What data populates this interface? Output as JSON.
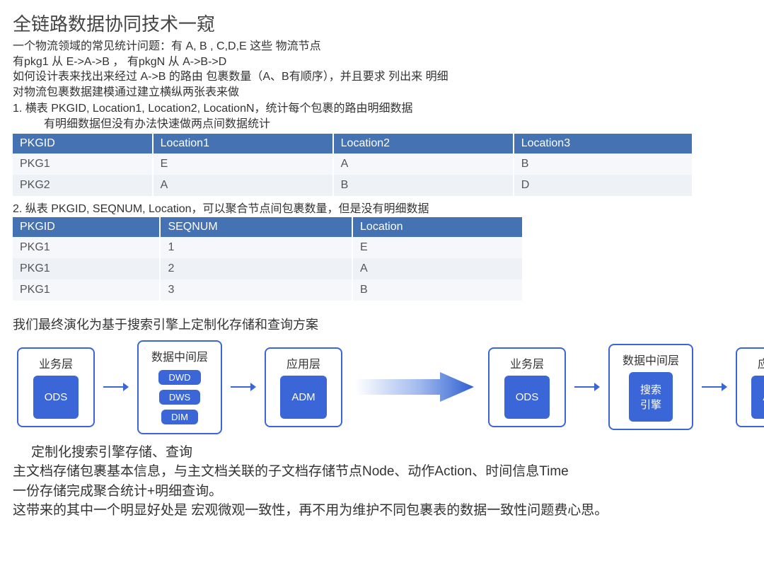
{
  "title": "全链路数据协同技术一窥",
  "intro": {
    "l1": "一个物流领域的常见统计问题：有 A, B , C,D,E 这些 物流节点",
    "l2": "有pkg1 从 E->A->B ，  有pkgN  从 A->B->D",
    "l3": "如何设计表来找出来经过 A->B 的路由 包裹数量（A、B有顺序），并且要求 列出来 明细",
    "l4": "对物流包裹数据建模通过建立横纵两张表来做",
    "list1": "1.     横表 PKGID, Location1, Location2, LocationN，统计每个包裹的路由明细数据",
    "list1sub": "有明细数据但没有办法快速做两点间数据统计"
  },
  "table1": {
    "headers": [
      "PKGID",
      "Location1",
      "Location2",
      "Location3"
    ],
    "rows": [
      [
        "PKG1",
        "E",
        "A",
        "B"
      ],
      [
        "PKG2",
        "A",
        "B",
        "D"
      ]
    ]
  },
  "mid": "2. 纵表 PKGID, SEQNUM, Location，可以聚合节点间包裹数量，但是没有明细数据",
  "table2": {
    "headers": [
      "PKGID",
      "SEQNUM",
      "Location"
    ],
    "rows": [
      [
        "PKG1",
        "1",
        "E"
      ],
      [
        "PKG1",
        "2",
        "A"
      ],
      [
        "PKG1",
        "3",
        "B"
      ]
    ]
  },
  "evolution": "我们最终演化为基于搜索引擎上定制化存储和查询方案",
  "diagram": {
    "left": {
      "biz": {
        "title": "业务层",
        "block": "ODS"
      },
      "mid": {
        "title": "数据中间层",
        "blocks": [
          "DWD",
          "DWS",
          "DIM"
        ]
      },
      "app": {
        "title": "应用层",
        "block": "ADM"
      }
    },
    "right": {
      "biz": {
        "title": "业务层",
        "block": "ODS"
      },
      "mid": {
        "title": "数据中间层",
        "block": "搜索\n引擎"
      },
      "app": {
        "title": "应用层",
        "block": "ADM"
      }
    }
  },
  "footer": {
    "t1": "定制化搜索引擎存储、查询",
    "t2": "主文档存储包裹基本信息，与主文档关联的子文档存储节点Node、动作Action、时间信息Time",
    "t3": "一份存储完成聚合统计+明细查询。",
    "t4": "这带来的其中一个明显好处是 宏观微观一致性，再不用为维护不同包裹表的数据一致性问题费心思。"
  }
}
